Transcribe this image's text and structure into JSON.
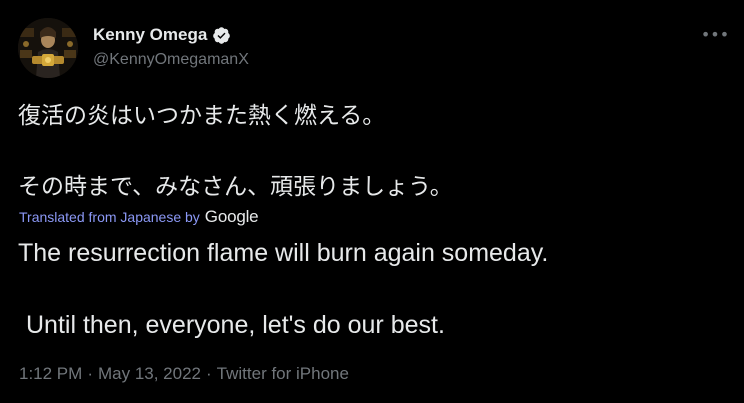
{
  "author": {
    "display_name": "Kenny Omega",
    "handle": "@KennyOmegamanX",
    "verified": true,
    "avatar_icon": "avatar-photo"
  },
  "menu": {
    "more_label": "•••"
  },
  "tweet": {
    "original_lines": [
      "復活の炎はいつかまた熱く燃える。",
      "その時まで、みなさん、頑張りましょう。"
    ],
    "translation_credit": "Translated from Japanese by",
    "translation_provider": "Google",
    "translated_lines": [
      "The resurrection flame will burn again someday.",
      "Until then, everyone, let's do our best."
    ]
  },
  "meta": {
    "time": "1:12 PM",
    "separator": "·",
    "date": "May 13, 2022",
    "source": "Twitter for iPhone"
  },
  "colors": {
    "background": "#000000",
    "text": "#e7e9ea",
    "muted": "#71767b",
    "translate_link": "#8b98f5",
    "verified_badge": "#e7e9ea"
  }
}
